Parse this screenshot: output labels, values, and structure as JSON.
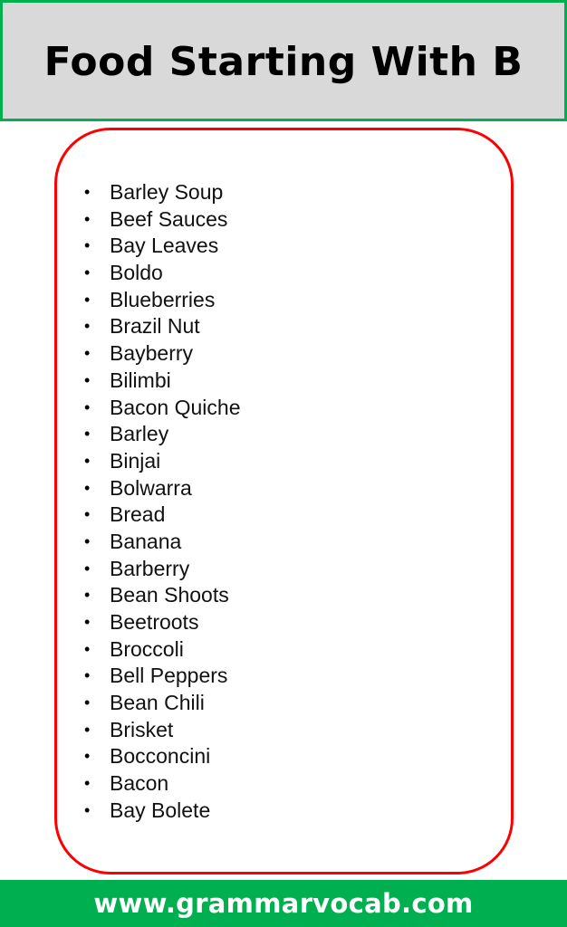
{
  "header": {
    "title": "Food Starting With B"
  },
  "list": {
    "bullet_glyph": "•",
    "items": [
      "Barley Soup",
      "Beef Sauces",
      "Bay Leaves",
      "Boldo",
      "Blueberries",
      "Brazil Nut",
      "Bayberry",
      "Bilimbi",
      "Bacon Quiche",
      "Barley",
      "Binjai",
      "Bolwarra",
      "Bread",
      "Banana",
      "Barberry",
      "Bean Shoots",
      "Beetroots",
      "Broccoli",
      "Bell Peppers",
      "Bean Chili",
      "Brisket",
      "Bocconcini",
      "Bacon",
      "Bay Bolete"
    ]
  },
  "footer": {
    "website": "www.grammarvocab.com"
  },
  "colors": {
    "accent_green": "#00b050",
    "frame_red": "#ff0000",
    "header_gray": "#d9d9d9"
  }
}
